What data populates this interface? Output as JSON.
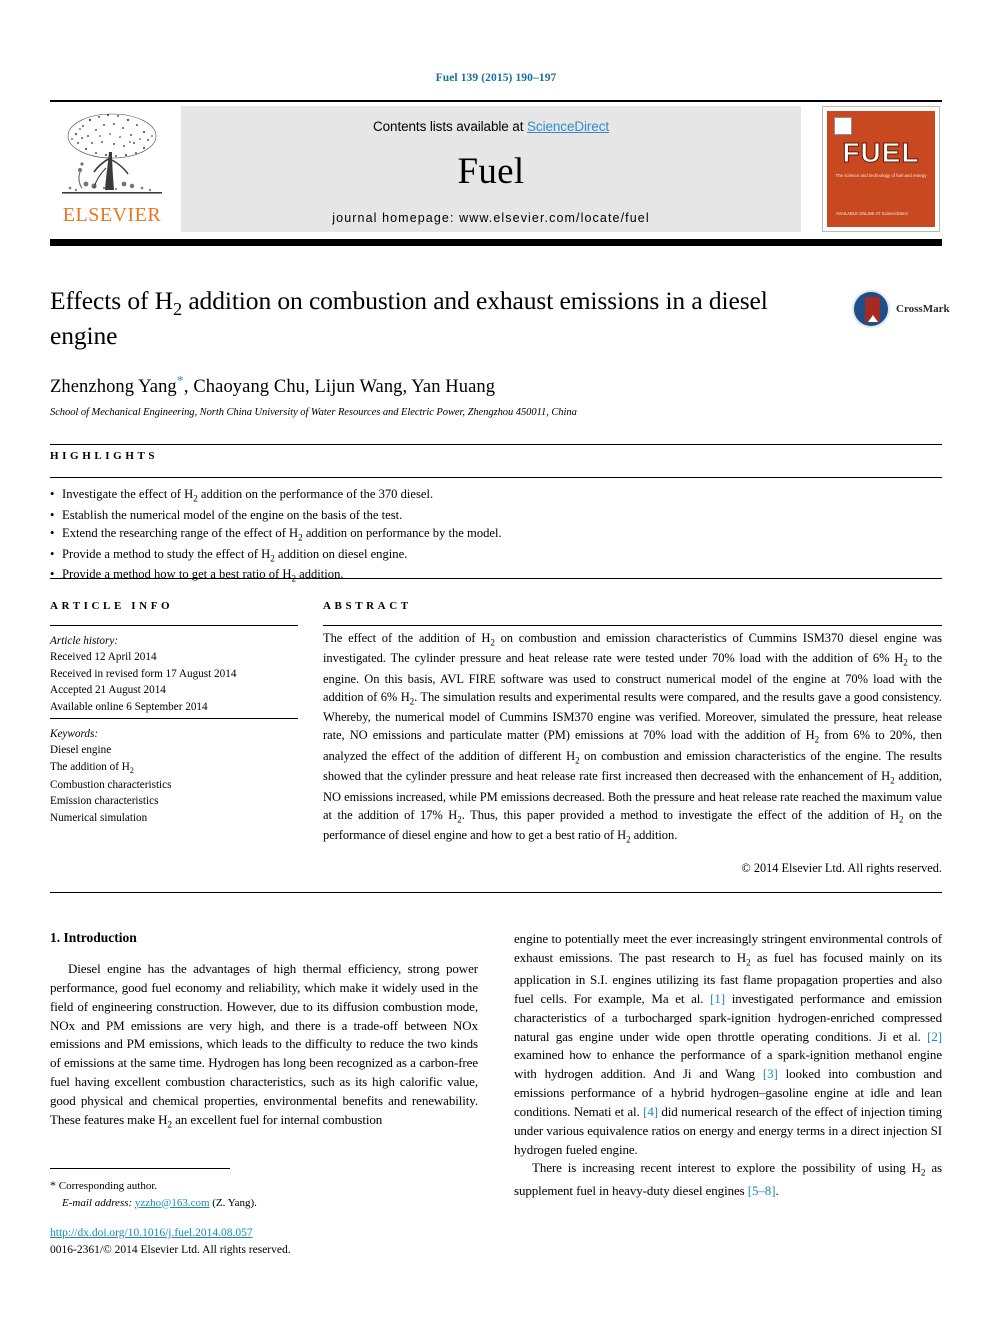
{
  "running_head": "Fuel 139 (2015) 190–197",
  "masthead": {
    "contents_prefix": "Contents lists available at ",
    "sciencedirect": "ScienceDirect",
    "journal_name": "Fuel",
    "homepage": "journal homepage: www.elsevier.com/locate/fuel",
    "publisher": "ELSEVIER",
    "cover_title": "FUEL",
    "cover_subtitle": "The science and technology of fuel and energy",
    "cover_footer": "AVAILABLE ONLINE AT\nScienceDirect"
  },
  "article": {
    "title": "Effects of H₂ addition on combustion and exhaust emissions in a diesel engine",
    "crossmark_label": "CrossMark",
    "authors": "Zhenzhong Yang",
    "authors_rest": ", Chaoyang Chu, Lijun Wang, Yan Huang",
    "corresponding_marker": "*",
    "affiliation": "School of Mechanical Engineering, North China University of Water Resources and Electric Power, Zhengzhou 450011, China"
  },
  "highlights": {
    "label": "HIGHLIGHTS",
    "items": [
      "Investigate the effect of H₂ addition on the performance of the 370 diesel.",
      "Establish the numerical model of the engine on the basis of the test.",
      "Extend the researching range of the effect of H₂ addition on performance by the model.",
      "Provide a method to study the effect of H₂ addition on diesel engine.",
      "Provide a method how to get a best ratio of H₂ addition."
    ]
  },
  "article_info": {
    "label": "ARTICLE INFO",
    "history_head": "Article history:",
    "history": [
      "Received 12 April 2014",
      "Received in revised form 17 August 2014",
      "Accepted 21 August 2014",
      "Available online 6 September 2014"
    ],
    "keywords_head": "Keywords:",
    "keywords": [
      "Diesel engine",
      "The addition of H₂",
      "Combustion characteristics",
      "Emission characteristics",
      "Numerical simulation"
    ]
  },
  "abstract": {
    "label": "ABSTRACT",
    "text": "The effect of the addition of H₂ on combustion and emission characteristics of Cummins ISM370 diesel engine was investigated. The cylinder pressure and heat release rate were tested under 70% load with the addition of 6% H₂ to the engine. On this basis, AVL FIRE software was used to construct numerical model of the engine at 70% load with the addition of 6% H₂. The simulation results and experimental results were compared, and the results gave a good consistency. Whereby, the numerical model of Cummins ISM370 engine was verified. Moreover, simulated the pressure, heat release rate, NO emissions and particulate matter (PM) emissions at 70% load with the addition of H₂ from 6% to 20%, then analyzed the effect of the addition of different H₂ on combustion and emission characteristics of the engine. The results showed that the cylinder pressure and heat release rate first increased then decreased with the enhancement of H₂ addition, NO emissions increased, while PM emissions decreased. Both the pressure and heat release rate reached the maximum value at the addition of 17% H₂. Thus, this paper provided a method to investigate the effect of the addition of H₂ on the performance of diesel engine and how to get a best ratio of H₂ addition.",
    "copyright": "© 2014 Elsevier Ltd. All rights reserved."
  },
  "introduction": {
    "section_title": "1. Introduction",
    "left_paragraph": "Diesel engine has the advantages of high thermal efficiency, strong power performance, good fuel economy and reliability, which make it widely used in the field of engineering construction. However, due to its diffusion combustion mode, NOx and PM emissions are very high, and there is a trade-off between NOx emissions and PM emissions, which leads to the difficulty to reduce the two kinds of emissions at the same time. Hydrogen has long been recognized as a carbon-free fuel having excellent combustion characteristics, such as its high calorific value, good physical and chemical properties, environmental benefits and renewability. These features make H₂ an excellent fuel for internal combustion",
    "right_paragraph_1": "engine to potentially meet the ever increasingly stringent environmental controls of exhaust emissions. The past research to H₂ as fuel has focused mainly on its application in S.I. engines utilizing its fast flame propagation properties and also fuel cells. For example, Ma et al. [1] investigated performance and emission characteristics of a turbocharged spark-ignition hydrogen-enriched compressed natural gas engine under wide open throttle operating conditions. Ji et al. [2] examined how to enhance the performance of a spark-ignition methanol engine with hydrogen addition. And Ji and Wang [3] looked into combustion and emissions performance of a hybrid hydrogen–gasoline engine at idle and lean conditions. Nemati et al. [4] did numerical research of the effect of injection timing under various equivalence ratios on energy and energy terms in a direct injection SI hydrogen fueled engine.",
    "right_paragraph_2": "There is increasing recent interest to explore the possibility of using H₂ as supplement fuel in heavy-duty diesel engines [5–8]."
  },
  "footnotes": {
    "corresponding": "Corresponding author.",
    "email_label": "E-mail address:",
    "email": "yzzho@163.com",
    "email_suffix": "(Z. Yang).",
    "doi": "http://dx.doi.org/10.1016/j.fuel.2014.08.057",
    "issn_line": "0016-2361/© 2014 Elsevier Ltd. All rights reserved."
  },
  "colors": {
    "link": "#1a8bb5",
    "elsevier_orange": "#E87722",
    "cover_red": "#c8491f"
  }
}
